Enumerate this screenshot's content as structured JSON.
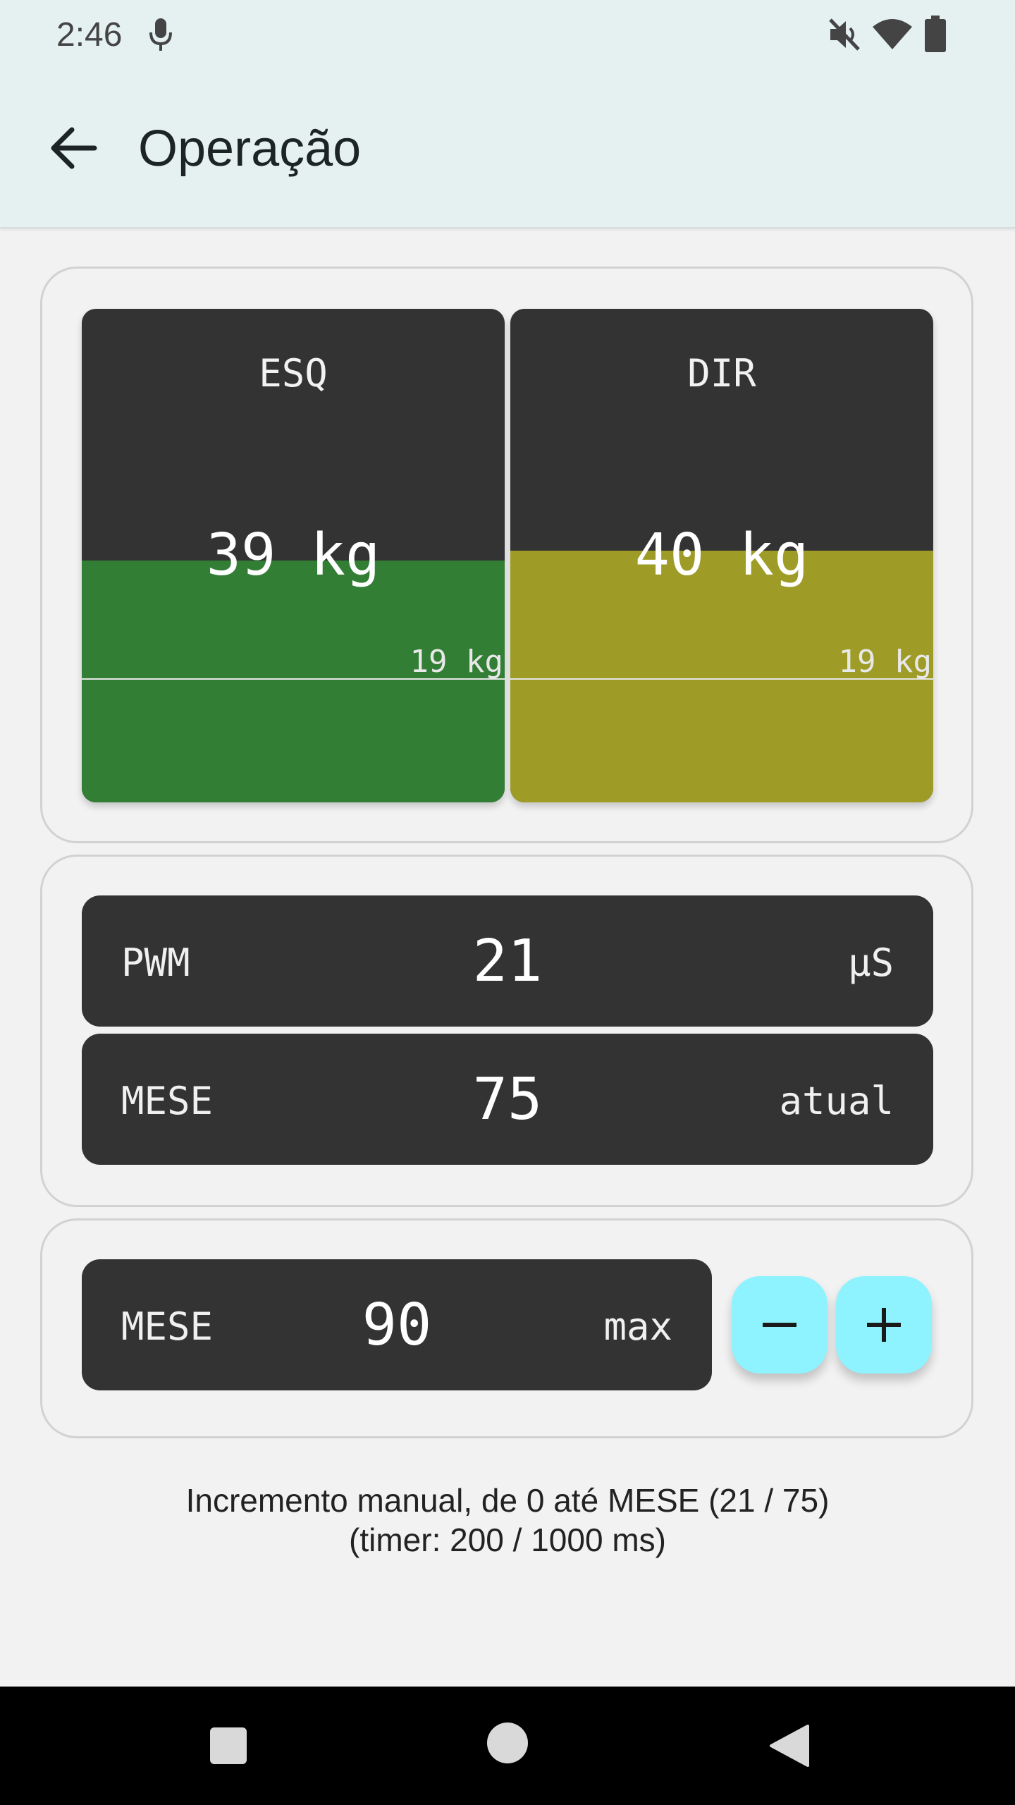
{
  "status_bar": {
    "time": "2:46",
    "icons": [
      "mic-icon",
      "volume-off-icon",
      "wifi-icon",
      "battery-icon"
    ]
  },
  "app_bar": {
    "title": "Operação",
    "back_icon": "arrow-left-icon"
  },
  "load_panel": {
    "left": {
      "label": "ESQ",
      "value": "39 kg",
      "threshold": "19 kg",
      "fill_color": "#327e35",
      "fill_fraction": 0.49
    },
    "right": {
      "label": "DIR",
      "value": "40 kg",
      "threshold": "19 kg",
      "fill_color": "#9e9c27",
      "fill_fraction": 0.51
    },
    "threshold_fraction": 0.25
  },
  "info_panel": {
    "pwm": {
      "label": "PWM",
      "value": "21",
      "unit": "μS"
    },
    "mese": {
      "label": "MESE",
      "value": "75",
      "unit": "atual"
    }
  },
  "max_panel": {
    "label": "MESE",
    "value": "90",
    "unit": "max",
    "minus_icon": "minus-icon",
    "plus_icon": "plus-icon"
  },
  "footer": {
    "line1": "Incremento manual, de 0 até MESE (21 / 75)",
    "line2": "(timer: 200 / 1000 ms)"
  },
  "nav_bar": {
    "icons": [
      "recent-apps-icon",
      "home-icon",
      "back-triangle-icon"
    ]
  }
}
